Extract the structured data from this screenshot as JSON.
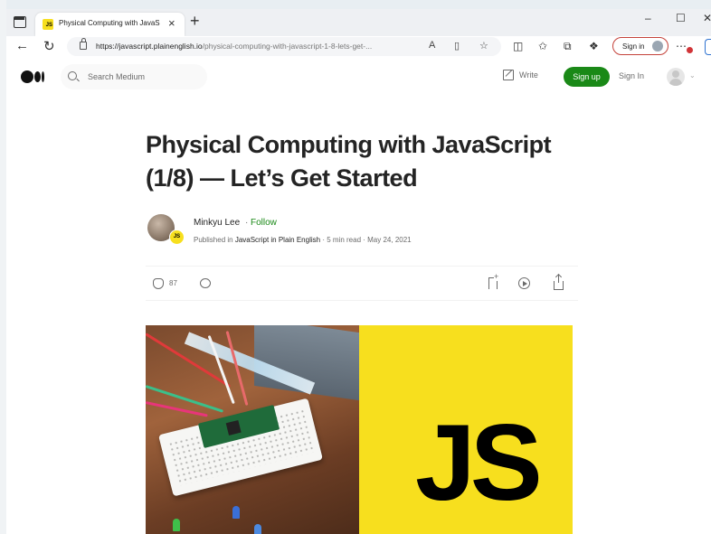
{
  "browser": {
    "tab_title": "Physical Computing with JavaScript",
    "tab_favicon": "JS",
    "url_host": "https://javascript.plainenglish.io",
    "url_path": "/physical-computing-with-javascript-1-8-lets-get-...",
    "profile_label": "Sign in",
    "window_controls": {
      "minimize": "–",
      "maximize": "☐",
      "close": "✕"
    }
  },
  "medium": {
    "search_placeholder": "Search Medium",
    "write_label": "Write",
    "signup_label": "Sign up",
    "signin_label": "Sign In"
  },
  "article": {
    "title": "Physical Computing with JavaScript (1/8) — Let’s Get Started",
    "author": "Minkyu Lee",
    "follow_label": "Follow",
    "published_in_prefix": "Published in ",
    "publication": "JavaScript in Plain English",
    "read_time": "5 min read",
    "date": "May 24, 2021",
    "claps": "87",
    "publication_badge": "JS",
    "hero_js_text": "JS"
  },
  "colors": {
    "medium_green": "#1a8917",
    "js_yellow": "#f7df1e",
    "text_primary": "#242424",
    "text_secondary": "#6b6b6b"
  }
}
